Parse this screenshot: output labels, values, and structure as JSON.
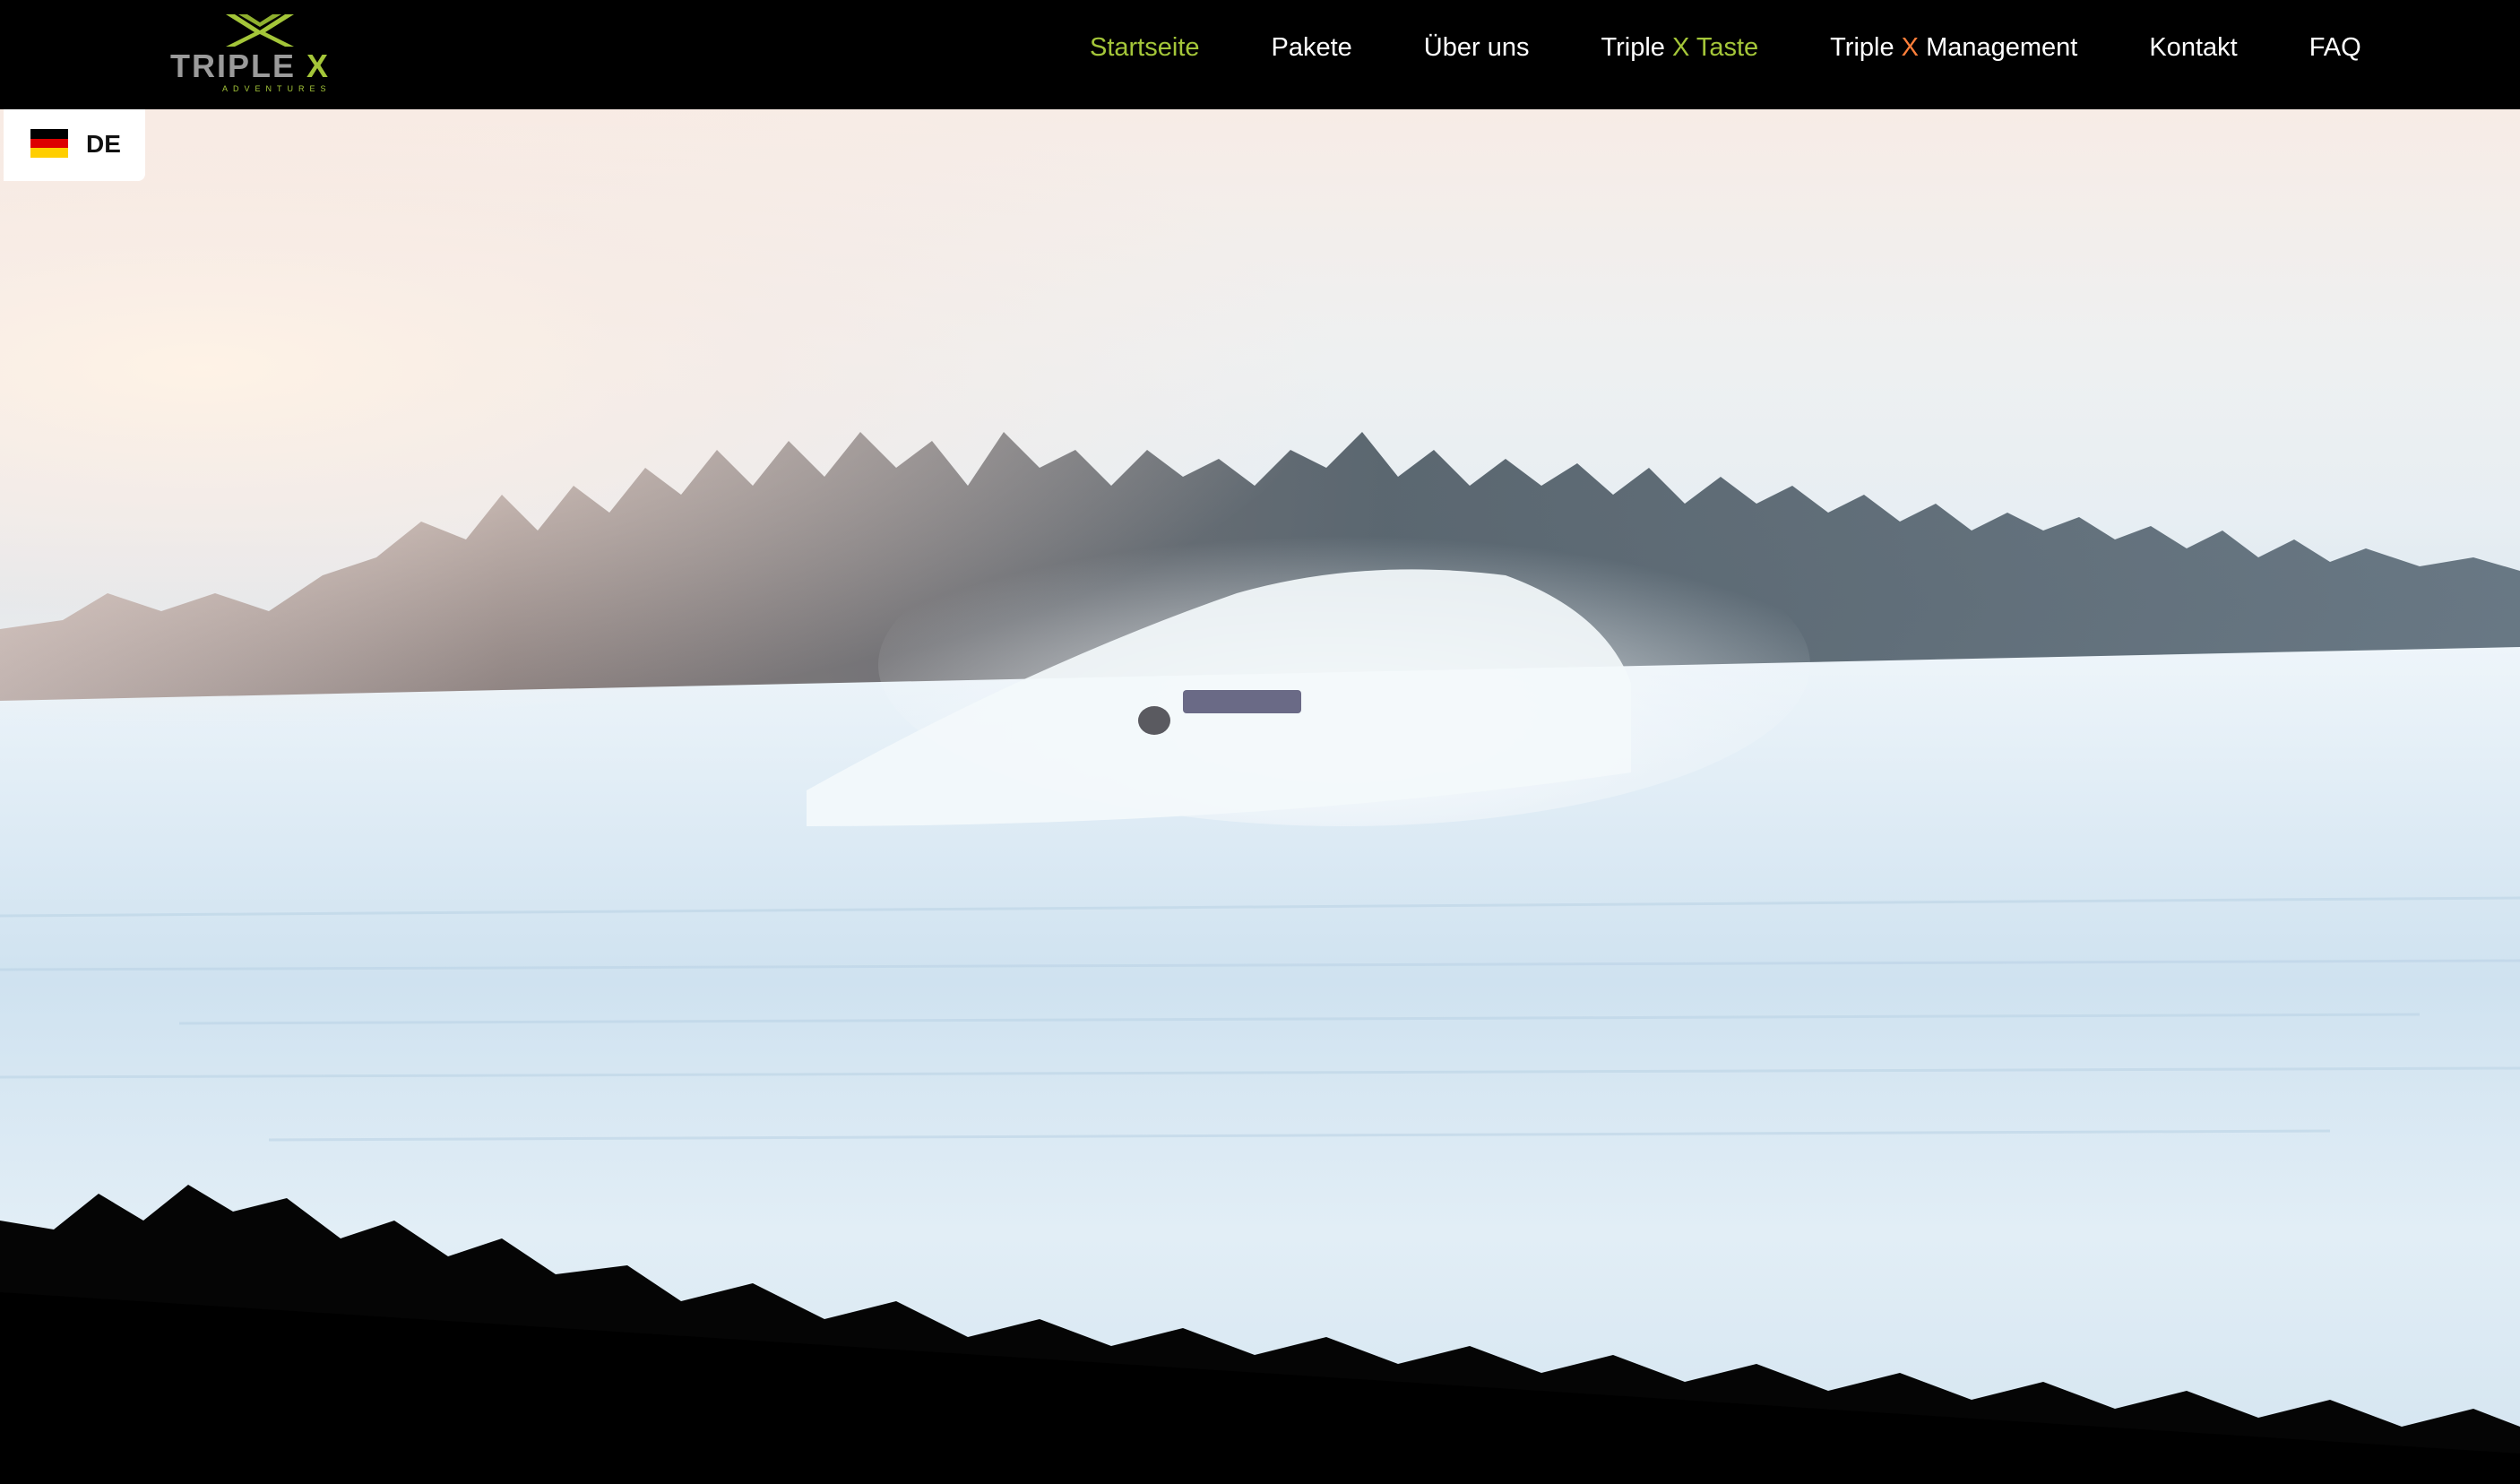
{
  "logo": {
    "word_part1": "TRIPLE",
    "word_part2": "X",
    "subtitle": "ADVENTURES"
  },
  "nav": {
    "items": [
      {
        "label": "Startseite",
        "active": true
      },
      {
        "label": "Pakete",
        "active": false
      },
      {
        "label": "Über uns",
        "active": false
      },
      {
        "label_prefix": "Triple ",
        "label_x": "X",
        "label_suffix": " Taste",
        "x_color": "green",
        "suffix_color": "green"
      },
      {
        "label_prefix": "Triple ",
        "label_x": "X",
        "label_suffix": " Management",
        "x_color": "orange",
        "suffix_color": "white"
      },
      {
        "label": "Kontakt",
        "active": false
      },
      {
        "label": "FAQ",
        "active": false
      }
    ]
  },
  "language": {
    "code": "DE",
    "flag_colors": [
      "#000000",
      "#dd0000",
      "#ffce00"
    ]
  },
  "colors": {
    "accent_green": "#a4c639",
    "accent_orange": "#ff7f3a",
    "nav_background": "#000000"
  },
  "icons": {
    "logo_mark": "triple-x-logo-icon",
    "language_flag": "germany-flag-icon"
  }
}
